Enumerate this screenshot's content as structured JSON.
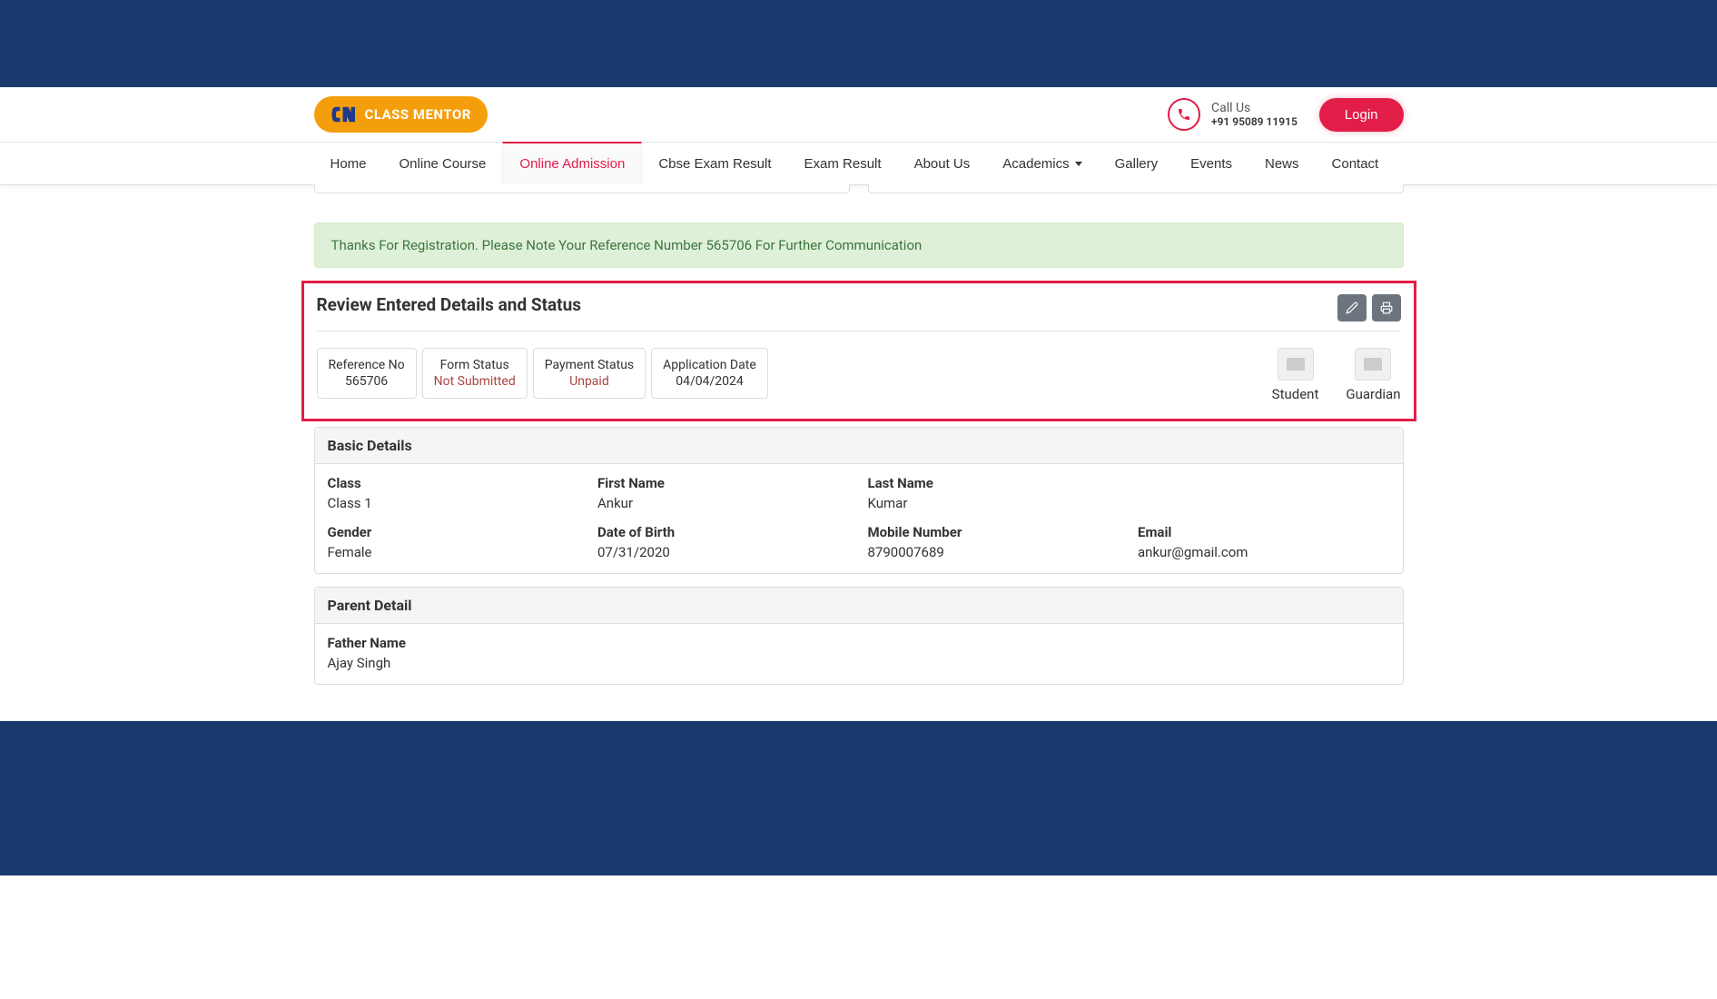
{
  "header": {
    "logo_text": "CLASS MENTOR",
    "call_label": "Call Us",
    "call_number": "+91 95089 11915",
    "login_label": "Login"
  },
  "nav": {
    "items": [
      {
        "label": "Home",
        "active": false
      },
      {
        "label": "Online Course",
        "active": false
      },
      {
        "label": "Online Admission",
        "active": true
      },
      {
        "label": "Cbse Exam Result",
        "active": false
      },
      {
        "label": "Exam Result",
        "active": false
      },
      {
        "label": "About Us",
        "active": false
      },
      {
        "label": "Academics",
        "active": false,
        "dropdown": true
      },
      {
        "label": "Gallery",
        "active": false
      },
      {
        "label": "Events",
        "active": false
      },
      {
        "label": "News",
        "active": false
      },
      {
        "label": "Contact",
        "active": false
      }
    ]
  },
  "alert": {
    "message": "Thanks For Registration. Please Note Your Reference Number 565706 For Further Communication"
  },
  "review": {
    "title": "Review Entered Details and Status",
    "status": {
      "reference_label": "Reference No",
      "reference_value": "565706",
      "form_label": "Form Status",
      "form_value": "Not Submitted",
      "payment_label": "Payment Status",
      "payment_value": "Unpaid",
      "date_label": "Application Date",
      "date_value": "04/04/2024"
    },
    "photos": {
      "student_label": "Student",
      "guardian_label": "Guardian"
    }
  },
  "basic": {
    "heading": "Basic Details",
    "class_label": "Class",
    "class_value": "Class 1",
    "first_name_label": "First Name",
    "first_name_value": "Ankur",
    "last_name_label": "Last Name",
    "last_name_value": "Kumar",
    "gender_label": "Gender",
    "gender_value": "Female",
    "dob_label": "Date of Birth",
    "dob_value": "07/31/2020",
    "mobile_label": "Mobile Number",
    "mobile_value": "8790007689",
    "email_label": "Email",
    "email_value": "ankur@gmail.com"
  },
  "parent": {
    "heading": "Parent Detail",
    "father_label": "Father Name",
    "father_value": "Ajay Singh"
  }
}
